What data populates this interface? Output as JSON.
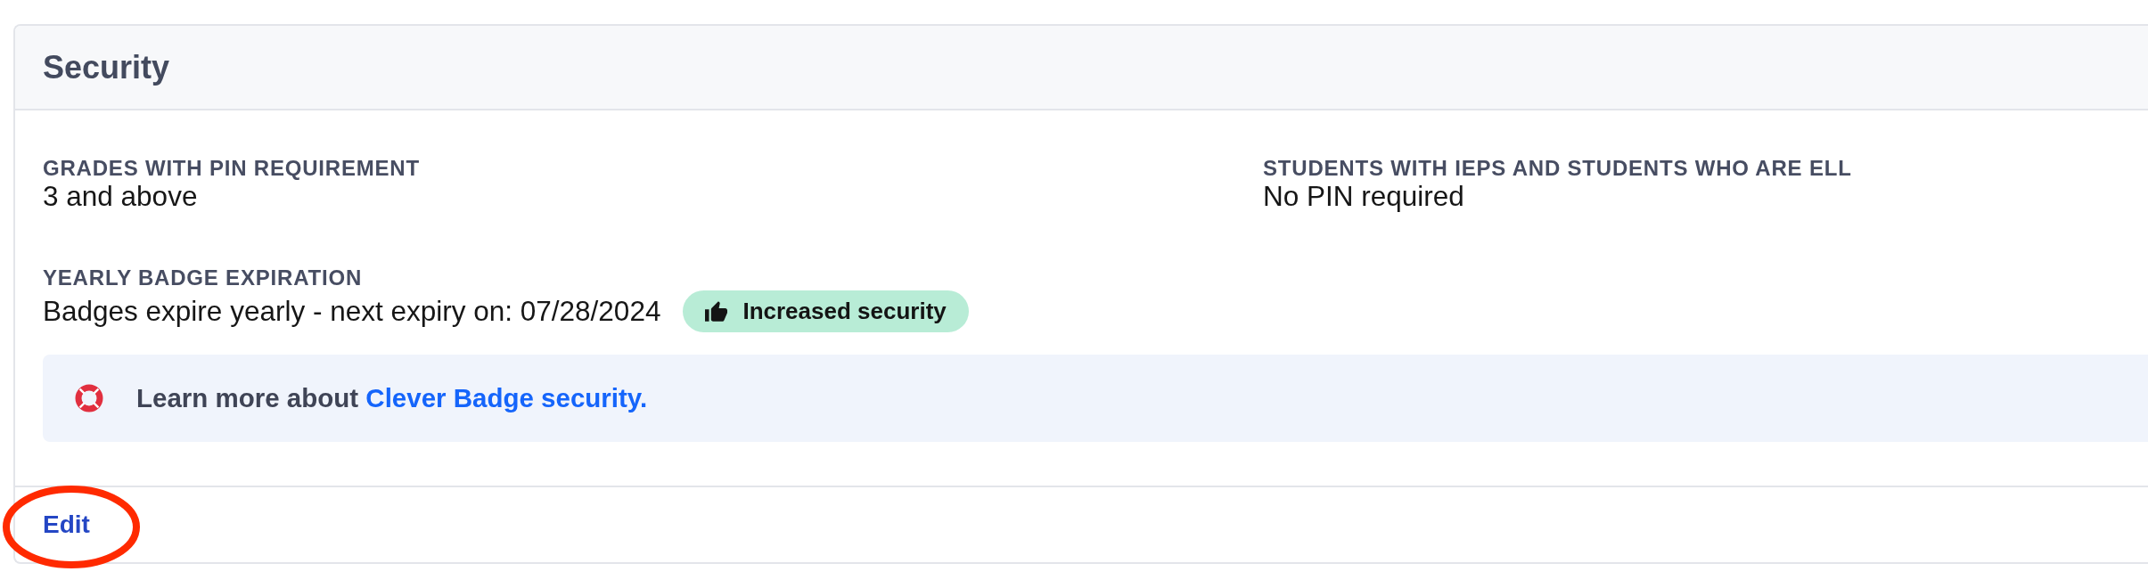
{
  "card": {
    "title": "Security"
  },
  "fields": [
    {
      "label": "GRADES WITH PIN REQUIREMENT",
      "value": "3 and above"
    },
    {
      "label": "STUDENTS WITH IEPS AND STUDENTS WHO ARE ELL",
      "value": "No PIN required"
    },
    {
      "label": "YEARLY BADGE EXPIRATION",
      "value": "Badges expire yearly - next expiry on: 07/28/2024",
      "badge": {
        "label": "Increased security"
      }
    }
  ],
  "help": {
    "text": "Learn more about",
    "link": "Clever Badge security."
  },
  "footer": {
    "edit": {
      "label": "Edit",
      "circled": true
    }
  }
}
